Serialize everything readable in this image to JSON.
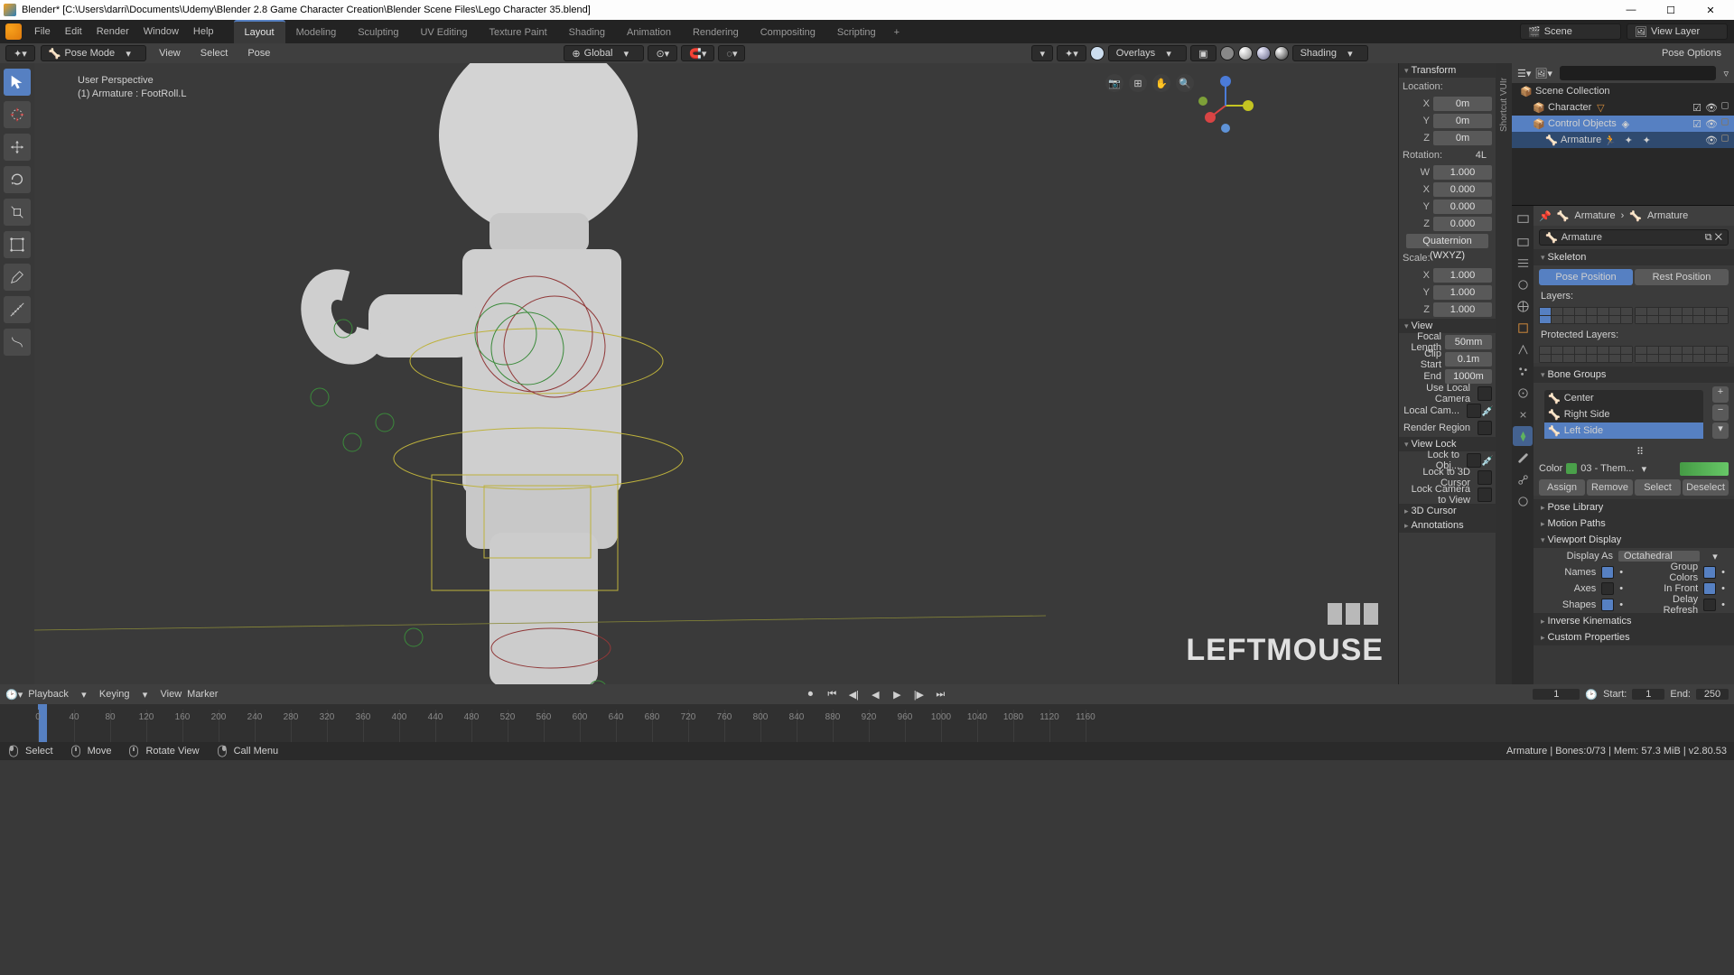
{
  "title": "Blender* [C:\\Users\\darri\\Documents\\Udemy\\Blender 2.8 Game Character Creation\\Blender Scene Files\\Lego Character 35.blend]",
  "menu": {
    "items": [
      "File",
      "Edit",
      "Render",
      "Window",
      "Help"
    ]
  },
  "workspaces": {
    "items": [
      "Layout",
      "Modeling",
      "Sculpting",
      "UV Editing",
      "Texture Paint",
      "Shading",
      "Animation",
      "Rendering",
      "Compositing",
      "Scripting"
    ],
    "active": "Layout"
  },
  "topright": {
    "scene_label": "Scene",
    "viewlayer_label": "View Layer"
  },
  "header3d": {
    "mode": "Pose Mode",
    "menus": [
      "View",
      "Select",
      "Pose"
    ],
    "orient": "Global",
    "overlays": "Overlays",
    "shading": "Shading",
    "pose_options": "Pose Options"
  },
  "viewport": {
    "persp": "User Perspective",
    "obj": "(1)  Armature : FootRoll.L",
    "overlay_text": "LEFTMOUSE"
  },
  "transform": {
    "hdr": "Transform",
    "location": {
      "label": "Location:",
      "X": "0m",
      "Y": "0m",
      "Z": "0m"
    },
    "rotation": {
      "label": "Rotation:",
      "mode_tag": "4L",
      "W": "1.000",
      "X": "0.000",
      "Y": "0.000",
      "Z": "0.000",
      "mode": "Quaternion (WXYZ)"
    },
    "scale": {
      "label": "Scale:",
      "X": "1.000",
      "Y": "1.000",
      "Z": "1.000"
    }
  },
  "view": {
    "hdr": "View",
    "focal_label": "Focal Length",
    "focal": "50mm",
    "clipstart_label": "Clip Start",
    "clipstart": "0.1m",
    "end_label": "End",
    "end": "1000m",
    "uselocalcam": "Use Local Camera",
    "localcam": "Local Cam...",
    "renderregion": "Render Region"
  },
  "viewlock": {
    "hdr": "View Lock",
    "lockobj": "Lock to Obj...",
    "lock3d": "Lock to 3D Cursor",
    "lockcam": "Lock Camera to View"
  },
  "cursor3d": {
    "hdr": "3D Cursor"
  },
  "annotations": {
    "hdr": "Annotations"
  },
  "ntabs": [
    "Shortcut VUIr"
  ],
  "outliner": {
    "root": "Scene Collection",
    "items": [
      {
        "name": "Character",
        "sel": false
      },
      {
        "name": "Control Objects",
        "sel": true
      },
      {
        "name": "Armature",
        "sel": false
      }
    ]
  },
  "bc": {
    "a": "Armature",
    "b": "Armature"
  },
  "armature_field": "Armature",
  "skeleton": {
    "hdr": "Skeleton",
    "pose": "Pose Position",
    "rest": "Rest Position",
    "layers": "Layers:",
    "protected": "Protected Layers:"
  },
  "bonegroups": {
    "hdr": "Bone Groups",
    "items": [
      "Center",
      "Right Side",
      "Left Side"
    ],
    "color_label": "Color",
    "color_set": "03 - Them...",
    "assign": "Assign",
    "remove": "Remove",
    "select": "Select",
    "deselect": "Deselect"
  },
  "poselib": {
    "hdr": "Pose Library"
  },
  "motionpaths": {
    "hdr": "Motion Paths"
  },
  "vpdisplay": {
    "hdr": "Viewport Display",
    "displayas_label": "Display As",
    "displayas": "Octahedral",
    "opts": [
      [
        "Names",
        "Group Colors"
      ],
      [
        "Axes",
        "In Front"
      ],
      [
        "Shapes",
        "Delay Refresh"
      ]
    ],
    "checks": {
      "Names": true,
      "GroupColors": true,
      "Axes": false,
      "InFront": true,
      "Shapes": true,
      "DelayRefresh": false
    }
  },
  "ik": {
    "hdr": "Inverse Kinematics"
  },
  "custom": {
    "hdr": "Custom Properties"
  },
  "timeline": {
    "playback": "Playback",
    "keying": "Keying",
    "view": "View",
    "marker": "Marker",
    "current": "1",
    "start_label": "Start:",
    "start": "1",
    "end_label": "End:",
    "end": "250",
    "ticks": [
      0,
      40,
      80,
      120,
      160,
      200,
      240,
      280,
      320,
      360,
      400,
      440,
      480,
      520,
      560,
      600,
      640,
      680,
      720,
      760,
      800,
      840,
      880,
      920,
      960,
      1000,
      1040,
      1080,
      1120,
      1160
    ]
  },
  "status": {
    "select": "Select",
    "move": "Move",
    "rotate": "Rotate View",
    "menu": "Call Menu",
    "right": "Armature | Bones:0/73 | Mem: 57.3 MiB | v2.80.53"
  }
}
